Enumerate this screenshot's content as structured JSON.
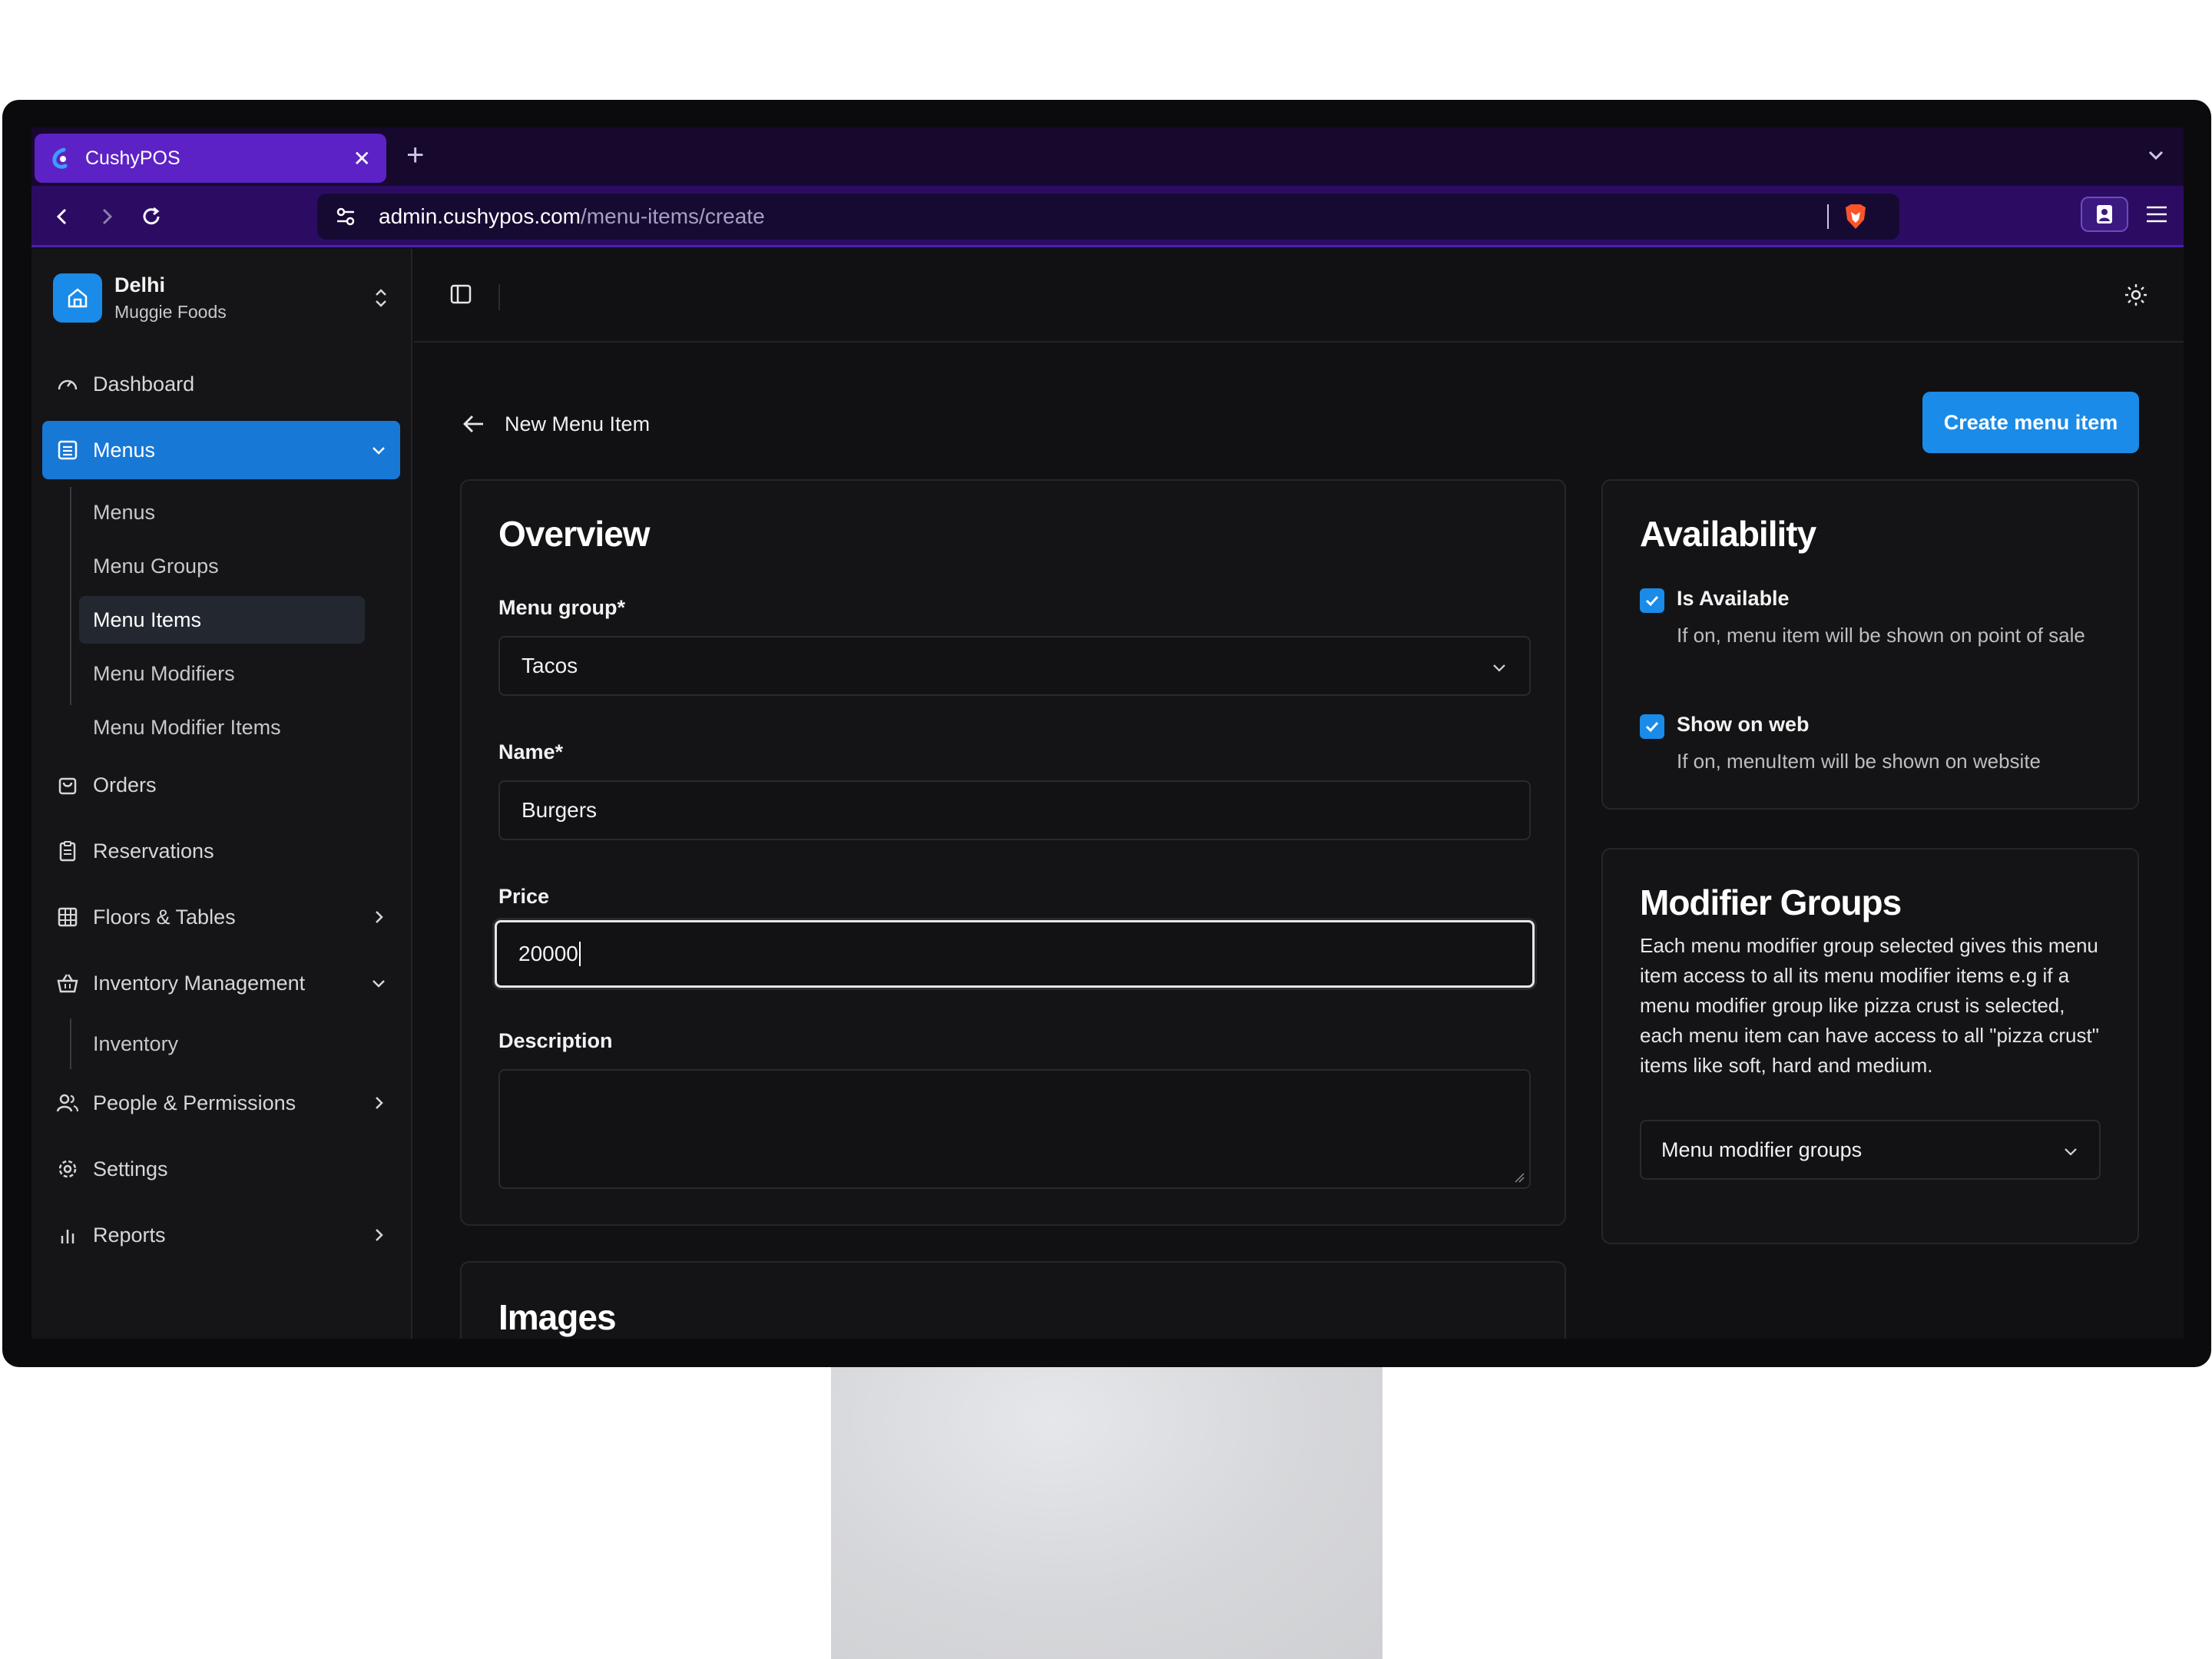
{
  "browser": {
    "tab_title": "CushyPOS",
    "tab_close": "✕",
    "new_tab": "+",
    "url_host": "admin.cushypos.com",
    "url_path": "/menu-items/create"
  },
  "sidebar": {
    "org_name": "Delhi",
    "org_sub": "Muggie Foods",
    "items": {
      "dashboard": "Dashboard",
      "menus": "Menus",
      "orders": "Orders",
      "reservations": "Reservations",
      "floors": "Floors & Tables",
      "inventory_mgmt": "Inventory Management",
      "people": "People & Permissions",
      "settings": "Settings",
      "reports": "Reports"
    },
    "menus_sub": [
      "Menus",
      "Menu Groups",
      "Menu Items",
      "Menu Modifiers",
      "Menu Modifier Items"
    ],
    "inventory_sub": [
      "Inventory"
    ]
  },
  "page": {
    "title": "New Menu Item",
    "create_button": "Create menu item"
  },
  "overview": {
    "title": "Overview",
    "menu_group_label": "Menu group*",
    "menu_group_value": "Tacos",
    "name_label": "Name*",
    "name_value": "Burgers",
    "price_label": "Price",
    "price_value": "20000",
    "description_label": "Description",
    "description_value": ""
  },
  "images": {
    "title": "Images"
  },
  "availability": {
    "title": "Availability",
    "is_available_label": "Is Available",
    "is_available_help": "If on, menu item will be shown on point of sale",
    "show_web_label": "Show on web",
    "show_web_help": "If on, menuItem will be shown on website"
  },
  "modifier_groups": {
    "title": "Modifier Groups",
    "description": "Each menu modifier group selected gives this menu item access to all its menu modifier items e.g if a menu modifier group like pizza crust is selected, each menu item can have access to all \"pizza crust\" items like soft, hard and medium.",
    "select_placeholder": "Menu modifier groups"
  },
  "colors": {
    "accent": "#1a8be8",
    "active_nav": "#1778d6",
    "tab_purple": "#5d22c5"
  }
}
